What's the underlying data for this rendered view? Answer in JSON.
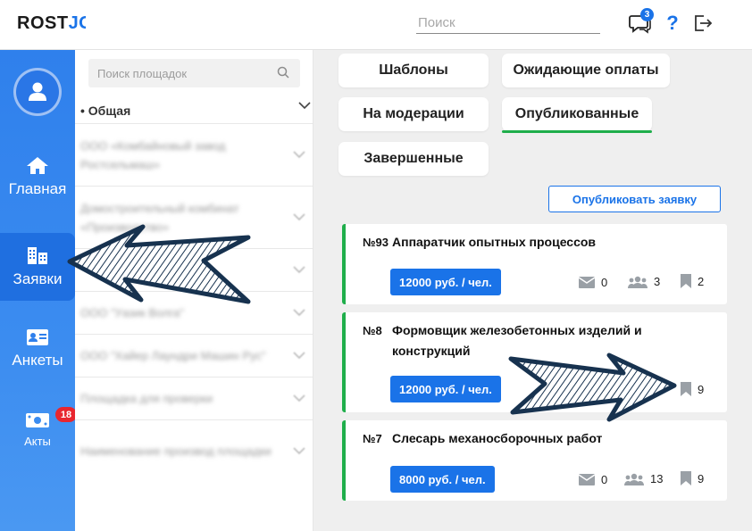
{
  "header": {
    "logo_main": "ROST",
    "logo_accent": "JO",
    "search_placeholder": "Поиск",
    "chat_badge": "3",
    "help_label": "?"
  },
  "sidebar": {
    "items": [
      {
        "label": "Главная",
        "icon": "home-icon"
      },
      {
        "label": "Заявки",
        "icon": "buildings-icon",
        "active": true
      },
      {
        "label": "Анкеты",
        "icon": "id-card-icon"
      },
      {
        "label": "Акты",
        "icon": "money-icon",
        "badge": "18"
      }
    ]
  },
  "sites": {
    "search_placeholder": "Поиск площадок",
    "group_label": "• Общая",
    "rows": [
      {
        "text": "ООО «Комбайновый завод Ростсельмаш»"
      },
      {
        "text": "Домостроительный комбинат «Производство»"
      },
      {
        "text": ""
      },
      {
        "text": "ООО \"Уазик Волга\""
      },
      {
        "text": "ООО \"Хайер Лаундри Машин Рус\""
      },
      {
        "text": "Площадка для проверки"
      },
      {
        "text": "Наименование производ площадки"
      }
    ]
  },
  "tabs": [
    {
      "label": "Шаблоны"
    },
    {
      "label": "Ожидающие оплаты"
    },
    {
      "label": "На модерации"
    },
    {
      "label": "Опубликованные",
      "active": true
    },
    {
      "label": "Завершенные"
    }
  ],
  "publish_button": "Опубликовать заявку",
  "cards": [
    {
      "number": "№93",
      "title": "Аппаратчик опытных процессов",
      "price": "12000 руб. / чел.",
      "messages": "0",
      "people": "3",
      "bookmarks": "2"
    },
    {
      "number": "№8",
      "title": "Формовщик железобетонных изделий и конструкций",
      "price": "12000 руб. / чел.",
      "bookmarks": "9"
    },
    {
      "number": "№7",
      "title": "Слесарь механосборочных работ",
      "price": "8000 руб. / чел.",
      "messages": "0",
      "people": "13",
      "bookmarks": "9"
    }
  ],
  "colors": {
    "accent": "#1a73e8",
    "sidebar": "#2f80ec",
    "success": "#1fae4b",
    "badge": "#e8262f",
    "arrow": "#17324f"
  }
}
